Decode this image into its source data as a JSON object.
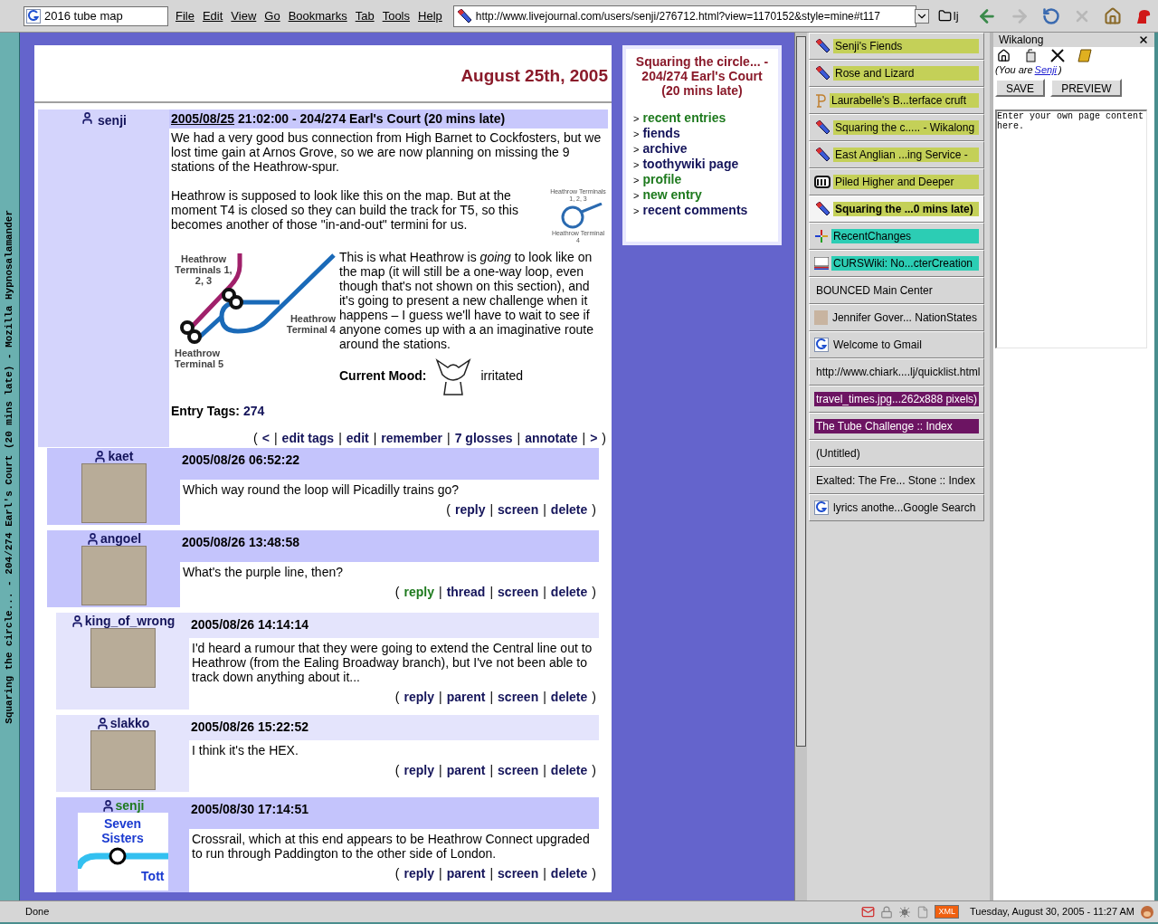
{
  "window_title": "Squaring the circle... - 204/274 Earl's Court (20 mins late) - Mozilla Hypnosalamander",
  "toolbar": {
    "search_value": "2016 tube map",
    "menus": [
      "File",
      "Edit",
      "View",
      "Go",
      "Bookmarks",
      "Tab",
      "Tools",
      "Help"
    ],
    "url": "http://www.livejournal.com/users/senji/276712.html?view=1170152&style=mine#t117",
    "bookmark": "lj"
  },
  "punctuation": {
    "open": "(",
    "sep": "|",
    "close": ")",
    "bullet": ">"
  },
  "page": {
    "date_heading": "August 25th, 2005",
    "entry": {
      "user": "senji",
      "date": "2005/08/25",
      "subject": "21:02:00 - 204/274 Earl's Court (20 mins late)",
      "paragraphs": [
        "We had a very good bus connection from High Barnet to Cockfosters, but we lost time gain at Arnos Grove, so we are now planning on missing the 9 stations of the Heathrow-spur.",
        "Heathrow is supposed to look like this on the map. But at the moment T4 is closed so they can build the track for T5, so this becomes another of those \"in-and-out\" termini for us.",
        "This is what Heathrow is *going* to look like on the map (it will still be a one-way loop, even though that's not shown on this section), and it's going to present a new challenge when it happens – I guess we'll have to wait to see if anyone comes up with a an imaginative route around the stations."
      ],
      "small_map_labels": [
        "Heathrow Terminals 1, 2, 3",
        "Heathrow Terminal 4"
      ],
      "map_labels": [
        "Heathrow Terminals 1, 2, 3",
        "Heathrow Terminal 4",
        "Heathrow Terminal 5"
      ],
      "mood_label": "Current Mood:",
      "mood": "irritated",
      "tags_label": "Entry Tags:",
      "tag": "274",
      "links": [
        {
          "label": "<",
          "visited": false
        },
        {
          "label": "edit tags",
          "visited": false
        },
        {
          "label": "edit",
          "visited": false
        },
        {
          "label": "remember",
          "visited": false
        },
        {
          "label": "7 glosses",
          "visited": false
        },
        {
          "label": "annotate",
          "visited": false
        },
        {
          "label": ">",
          "visited": false
        }
      ]
    },
    "comments": [
      {
        "user": "kaet",
        "user_visited": false,
        "kind": "dark",
        "avatar": {
          "kind": "photo"
        },
        "date": "2005/08/26 06:52:22",
        "text": "Which way round the loop will Picadilly trains go?",
        "links": [
          {
            "label": "reply",
            "visited": false
          },
          {
            "label": "screen",
            "visited": false
          },
          {
            "label": "delete",
            "visited": false
          }
        ]
      },
      {
        "user": "angoel",
        "user_visited": false,
        "kind": "dark",
        "avatar": {
          "kind": "photo"
        },
        "date": "2005/08/26 13:48:58",
        "text": "What's the purple line, then?",
        "links": [
          {
            "label": "reply",
            "visited": true
          },
          {
            "label": "thread",
            "visited": false
          },
          {
            "label": "screen",
            "visited": false
          },
          {
            "label": "delete",
            "visited": false
          }
        ],
        "children": [
          {
            "user": "king_of_wrong",
            "user_visited": false,
            "kind": "light",
            "avatar": {
              "kind": "photo"
            },
            "date": "2005/08/26 14:14:14",
            "text": "I'd heard a rumour that they were going to extend the Central line out to Heathrow (from the Ealing Broadway branch), but I've not been able to track down anything about it...",
            "links": [
              {
                "label": "reply",
                "visited": false
              },
              {
                "label": "parent",
                "visited": false
              },
              {
                "label": "screen",
                "visited": false
              },
              {
                "label": "delete",
                "visited": false
              }
            ]
          },
          {
            "user": "slakko",
            "user_visited": false,
            "kind": "light",
            "avatar": {
              "kind": "photo"
            },
            "date": "2005/08/26 15:22:52",
            "text": "I think it's the HEX.",
            "links": [
              {
                "label": "reply",
                "visited": false
              },
              {
                "label": "parent",
                "visited": false
              },
              {
                "label": "screen",
                "visited": false
              },
              {
                "label": "delete",
                "visited": false
              }
            ]
          },
          {
            "user": "senji",
            "user_visited": true,
            "kind": "dark",
            "avatar": {
              "kind": "map",
              "labels": [
                "Seven",
                "Sisters",
                "Tott"
              ]
            },
            "date": "2005/08/30 17:14:51",
            "text": "Crossrail, which at this end appears to be Heathrow Connect upgraded to run through Paddington to the other side of London.",
            "links": [
              {
                "label": "reply",
                "visited": false
              },
              {
                "label": "parent",
                "visited": false
              },
              {
                "label": "screen",
                "visited": false
              },
              {
                "label": "delete",
                "visited": false
              }
            ]
          }
        ]
      }
    ]
  },
  "sidebar": {
    "title": "Squaring the circle... - 204/274 Earl's Court (20 mins late)",
    "items": [
      {
        "label": "recent entries",
        "visited": true
      },
      {
        "label": "fiends",
        "visited": false
      },
      {
        "label": "archive",
        "visited": false
      },
      {
        "label": "toothywiki page",
        "visited": false
      },
      {
        "label": "profile",
        "visited": true
      },
      {
        "label": "new entry",
        "visited": true
      },
      {
        "label": "recent comments",
        "visited": false
      }
    ]
  },
  "tabs": [
    {
      "label": "Senji's Fiends",
      "kind": "pencil",
      "color": "#c4d058",
      "selected": false
    },
    {
      "label": "Rose and Lizard",
      "kind": "pencil",
      "color": "#c4d058",
      "selected": false
    },
    {
      "label": "Laurabelle's B...terface cruft",
      "kind": "letter",
      "color": "#c4d058",
      "selected": false
    },
    {
      "label": "Squaring the c..... - Wikalong",
      "kind": "pencil",
      "color": "#c4d058",
      "selected": false
    },
    {
      "label": "East Anglian ...ing Service -",
      "kind": "pencil",
      "color": "#c4d058",
      "selected": false
    },
    {
      "label": "Piled Higher and Deeper",
      "kind": "phd",
      "color": "#c4d058",
      "selected": false
    },
    {
      "label": "Squaring the ...0 mins late)",
      "kind": "pencil",
      "color": "#c4d058",
      "selected": true
    },
    {
      "label": "RecentChanges",
      "kind": "arrows",
      "color": "#2ccdb4",
      "selected": false
    },
    {
      "label": "CURSWiki: No...cterCreation",
      "kind": "logo",
      "color": "#2ccdb4",
      "selected": false
    },
    {
      "label": "BOUNCED Main Center",
      "kind": "none",
      "selected": false
    },
    {
      "label": "Jennifer Gover... NationStates",
      "kind": "photo",
      "selected": false
    },
    {
      "label": "Welcome to Gmail",
      "kind": "google",
      "selected": false
    },
    {
      "label": "http://www.chiark....lj/quicklist.html",
      "kind": "none",
      "selected": false
    },
    {
      "label": "travel_times.jpg...262x888 pixels)",
      "kind": "none",
      "color": "#6c1462",
      "selected": false
    },
    {
      "label": "The Tube Challenge :: Index",
      "kind": "none",
      "color": "#6c1462",
      "selected": false
    },
    {
      "label": "(Untitled)",
      "kind": "none",
      "selected": false
    },
    {
      "label": "Exalted: The Fre... Stone :: Index",
      "kind": "none",
      "selected": false
    },
    {
      "label": "lyrics anothe...Google Search",
      "kind": "google",
      "selected": false
    }
  ],
  "wikalong": {
    "title": "Wikalong",
    "you_are": "(You are",
    "user": "Senji",
    "you_are_end": ")",
    "buttons": [
      "SAVE",
      "PREVIEW"
    ],
    "content": "Enter your own page content here."
  },
  "status_bar": {
    "text": "Done",
    "xml": "XML",
    "clock": "Tuesday, August 30, 2005 - 11:27 AM"
  }
}
